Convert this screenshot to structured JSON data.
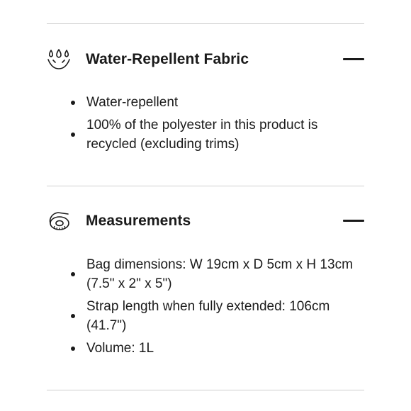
{
  "sections": [
    {
      "title": "Water-Repellent Fabric",
      "icon": "water-drops-icon",
      "expanded": true,
      "items": [
        "Water-repellent",
        "100% of the polyester in this product is recycled (excluding trims)"
      ]
    },
    {
      "title": "Measurements",
      "icon": "tape-measure-icon",
      "expanded": true,
      "items": [
        "Bag dimensions: W 19cm x D 5cm x H 13cm (7.5\" x 2\" x 5\")",
        "Strap length when fully extended: 106cm (41.7\")",
        "Volume: 1L"
      ]
    }
  ],
  "colors": {
    "text": "#1a1a1a",
    "divider": "#cfcfcf",
    "background": "#ffffff"
  }
}
